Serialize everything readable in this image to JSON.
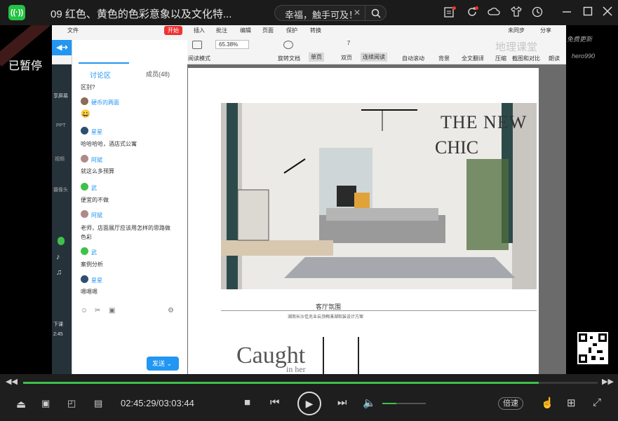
{
  "titlebar": {
    "logo_text": "((·))",
    "video_title": "09 红色、黄色的色彩意象以及文化特...",
    "search_text": "幸福，触手可及！",
    "search_clear": "✕",
    "search_icon": "search-icon",
    "icons": [
      "clipboard-icon",
      "refresh-icon",
      "cloud-icon",
      "tshirt-icon",
      "clock-icon",
      "minimize-icon",
      "maximize-icon",
      "close-icon"
    ]
  },
  "overlay": {
    "paused": "已暂停"
  },
  "wps": {
    "menus": [
      "文件",
      "开始",
      "插入",
      "批注",
      "编辑",
      "页面",
      "保护",
      "转换"
    ],
    "sync": "未同步",
    "share": "分享",
    "zoom": "65.38%",
    "page": "7",
    "read_mode": "阅读模式",
    "rotate": "旋转文档",
    "single": "单页",
    "double": "双页",
    "continuous": "连续阅读",
    "autoscroll": "自动滚动",
    "background": "背景",
    "translate": "全文翻译",
    "compress": "压缩",
    "compare": "截图和对比",
    "read_aloud": "朗读",
    "overlay_text": "地理课堂"
  },
  "document": {
    "chic_line1": "THE NEW",
    "chic_line2": "CHIC",
    "caption": "客厅氛围",
    "subcaption": "湖南长沙佳兆业云顶梅溪湖软装设计方案",
    "page2_title": "Caught",
    "page2_sub": "in her"
  },
  "chat": {
    "tab_discussion": "讨论区",
    "tab_members": "成员(48)",
    "messages": [
      {
        "name": "",
        "text": "区别?"
      },
      {
        "name": "硬币的两面",
        "text": "😀"
      },
      {
        "name": "星星",
        "text": "哈哈哈哈，酒店式公寓"
      },
      {
        "name": "阿斌",
        "text": "就这么多预算"
      },
      {
        "name": "武",
        "text": "便宜的不做"
      },
      {
        "name": "阿斌",
        "text": "老师，店面展厅应该用怎样的思路做"
      },
      {
        "name": "",
        "text": "色彩"
      },
      {
        "name": "武",
        "text": "案例分析"
      },
      {
        "name": "星星",
        "text": "嗯嗯嗯"
      }
    ],
    "send": "发送",
    "left_labels": [
      "享屏幕",
      "PPT",
      "视频",
      "摄像头",
      "下课",
      "2:45"
    ]
  },
  "watermark": {
    "line1": "免费更新",
    "line2": "hero990"
  },
  "player": {
    "time": "02:45:29/03:03:44",
    "progress": 0.898,
    "volume": 0.33,
    "speed": "倍速",
    "accent": "#3ec14c"
  }
}
